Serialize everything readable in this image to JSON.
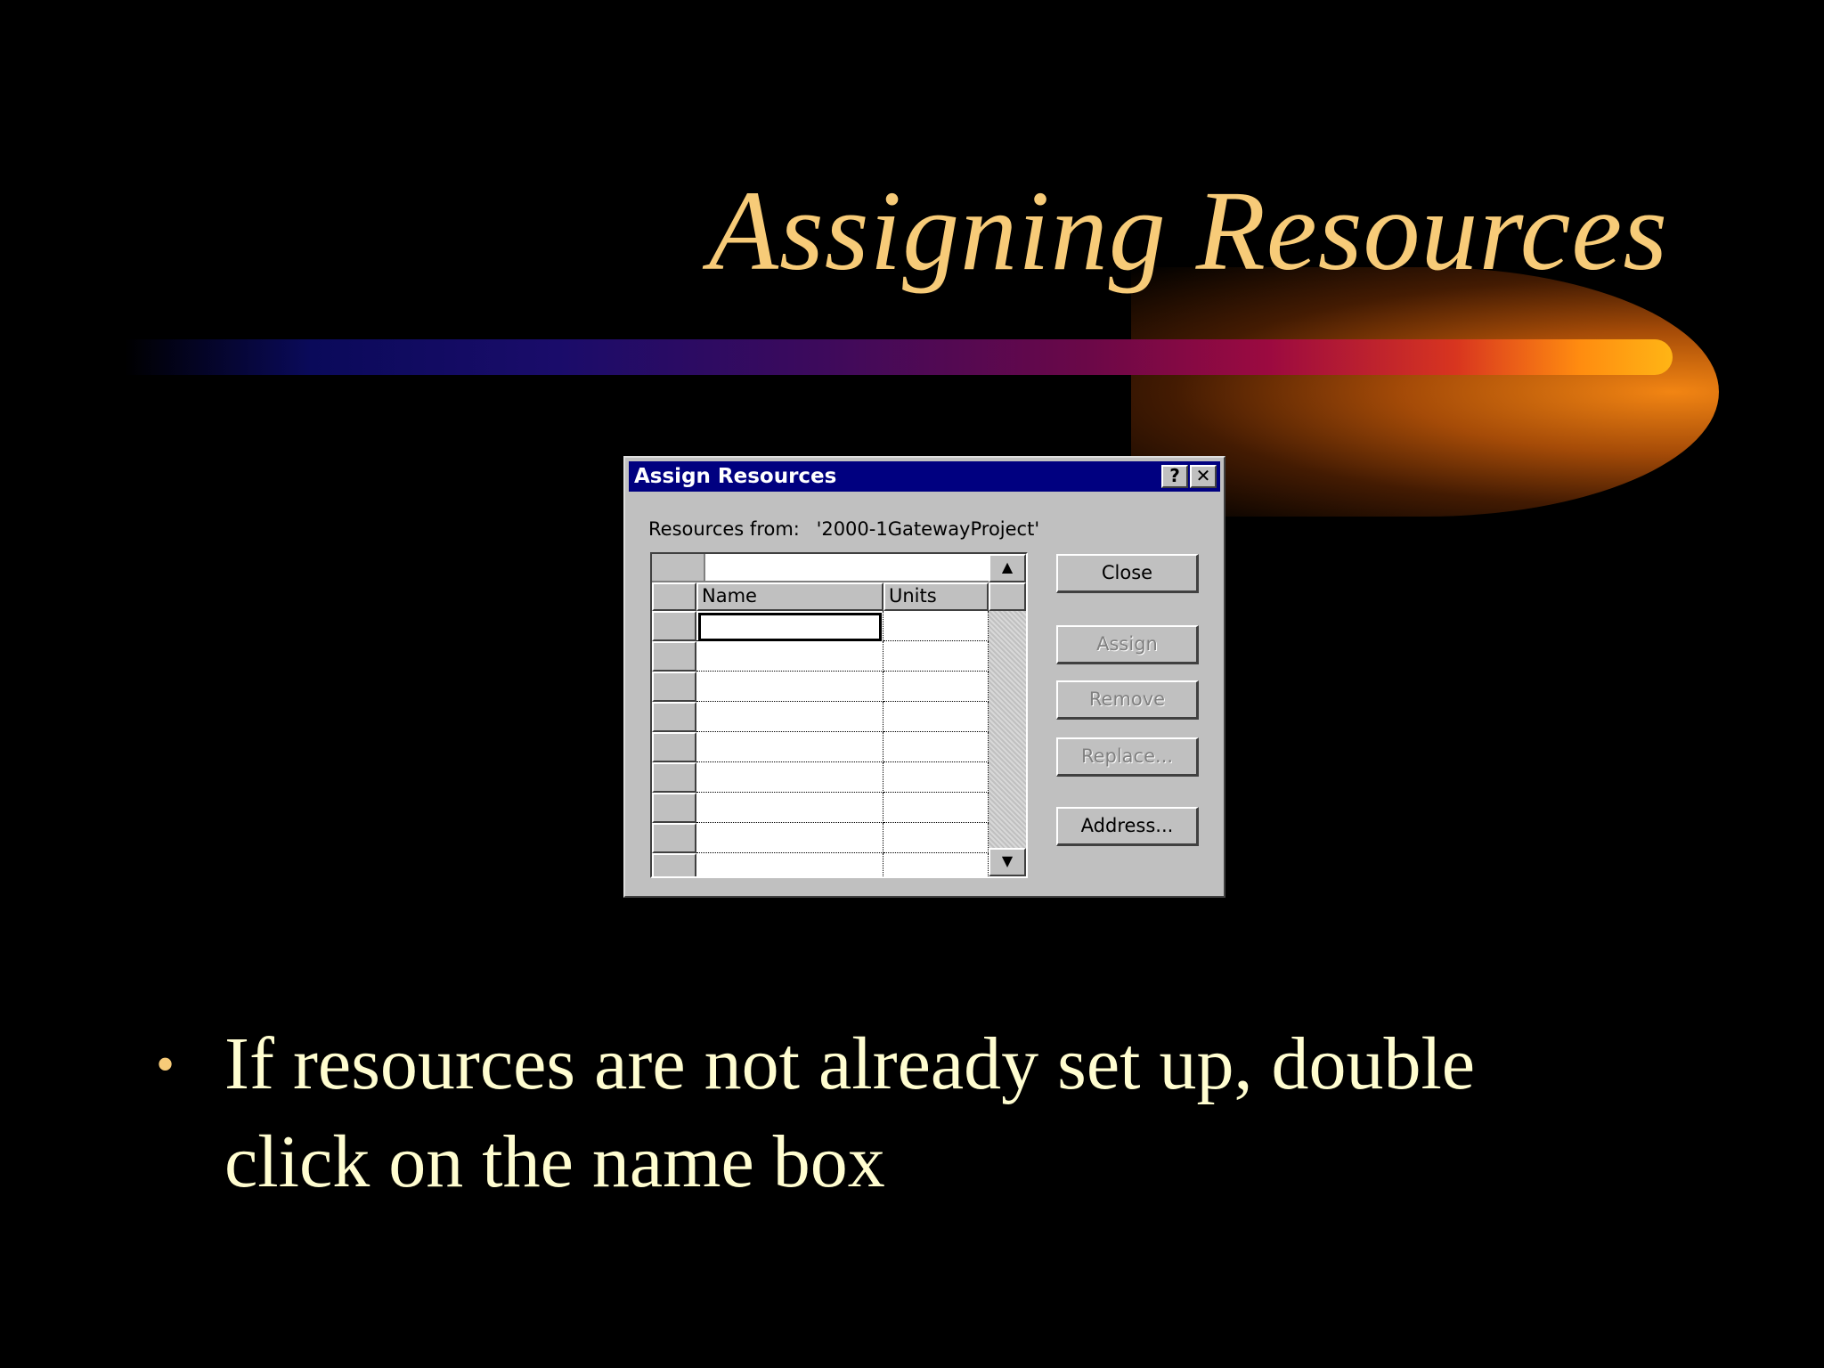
{
  "slide": {
    "title": "Assigning Resources",
    "bullet_symbol": "•",
    "bullet_text": "If resources are not already set up, double click on the name box"
  },
  "colors": {
    "title": "#f7cb78",
    "bullet_text": "#fffdd0",
    "background": "#000000",
    "dialog_titlebar": "#000080"
  },
  "dialog": {
    "title": "Assign Resources",
    "help_glyph": "?",
    "close_glyph": "✕",
    "resources_from_label": "Resources from:",
    "resources_from_value": "'2000-1GatewayProject'",
    "columns": [
      "Name",
      "Units"
    ],
    "rows": [
      "",
      "",
      "",
      "",
      "",
      "",
      "",
      "",
      ""
    ],
    "buttons": {
      "close": "Close",
      "assign": "Assign",
      "remove": "Remove",
      "replace": "Replace...",
      "address": "Address..."
    },
    "scroll_up_glyph": "▲",
    "scroll_down_glyph": "▼"
  }
}
